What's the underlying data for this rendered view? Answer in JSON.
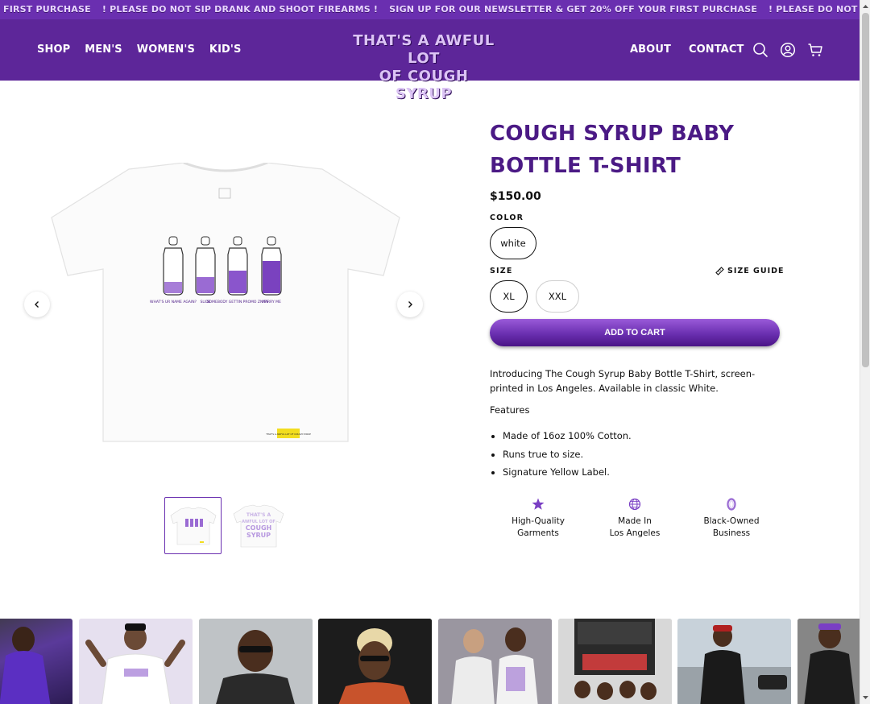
{
  "announcement": {
    "items": [
      "FIRST PURCHASE",
      "! PLEASE DO NOT SIP DRANK AND SHOOT FIREARMS !",
      "SIGN UP FOR OUR NEWSLETTER & GET 20% OFF YOUR FIRST PURCHASE",
      "! PLEASE DO NOT SIP DRANK AND SHO"
    ]
  },
  "header": {
    "nav_left": [
      "SHOP",
      "MEN'S",
      "WOMEN'S",
      "KID'S"
    ],
    "logo_line1": "THAT'S A AWFUL LOT",
    "logo_line2": "OF COUGH SYRUP",
    "nav_right": [
      "ABOUT",
      "CONTACT"
    ],
    "icons": [
      "search-icon",
      "account-icon",
      "cart-icon"
    ]
  },
  "product": {
    "title": "COUGH SYRUP BABY BOTTLE T-SHIRT",
    "price": "$150.00",
    "color_label": "COLOR",
    "colors": [
      "white"
    ],
    "selected_color": "white",
    "size_label": "SIZE",
    "size_guide": "SIZE GUIDE",
    "sizes": [
      "XL",
      "XXL"
    ],
    "selected_size": "XL",
    "add_to_cart": "ADD TO CART",
    "description": "Introducing The Cough Syrup Baby Bottle T-Shirt, screen-printed in Los Angeles. Available in classic White.",
    "features_label": "Features",
    "features": [
      "Made of 16oz 100% Cotton.",
      "Runs true to size.",
      "Signature Yellow Label."
    ],
    "shirt_print_labels": [
      "WHAT'S UR NAME AGAIN?",
      "SLIDE",
      "SOMEBODY GETTIN PROMO ZNITS",
      "MARRY ME"
    ],
    "tag_text": "THAT'S A AWFUL LOT OF COUGH SYRUP",
    "back_print": [
      "THAT'S A",
      "AWFUL LOT OF",
      "COUGH",
      "SYRUP"
    ]
  },
  "badges": [
    {
      "icon": "star-icon",
      "text": "High-Quality\nGarments"
    },
    {
      "icon": "globe-icon",
      "text": "Made In\nLos Angeles"
    },
    {
      "icon": "ring-icon",
      "text": "Black-Owned\nBusiness"
    }
  ],
  "colors": {
    "brand_purple": "#5d2699",
    "title_purple": "#4b1a85",
    "accent": "#6a2fb0"
  }
}
